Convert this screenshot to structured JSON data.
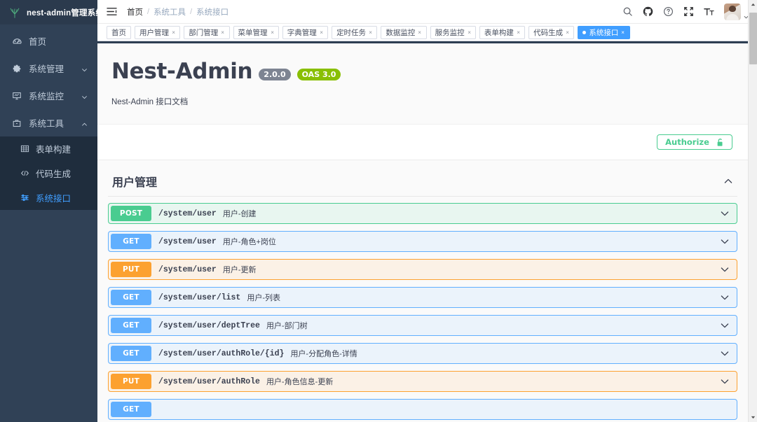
{
  "sidebar": {
    "logo_text": "nest-admin管理系统",
    "logo_icon": "plant-leaf-icon",
    "items": [
      {
        "label": "首页",
        "icon": "dashboard-icon",
        "has_caret": false
      },
      {
        "label": "系统管理",
        "icon": "gear-icon",
        "has_caret": true
      },
      {
        "label": "系统监控",
        "icon": "monitor-icon",
        "has_caret": true
      },
      {
        "label": "系统工具",
        "icon": "toolbox-icon",
        "has_caret": true,
        "expanded": true
      }
    ],
    "submenu": [
      {
        "label": "表单构建",
        "icon": "table-icon",
        "active": false
      },
      {
        "label": "代码生成",
        "icon": "code-icon",
        "active": false
      },
      {
        "label": "系统接口",
        "icon": "sliders-icon",
        "active": true
      }
    ]
  },
  "navbar": {
    "hamburger_icon": "hamburger-icon",
    "breadcrumb": [
      {
        "label": "首页",
        "link": false
      },
      {
        "label": "系统工具",
        "link": true
      },
      {
        "label": "系统接口",
        "link": true
      }
    ],
    "separator": "/",
    "icons": [
      {
        "name": "search-icon"
      },
      {
        "name": "github-icon"
      },
      {
        "name": "help-icon"
      },
      {
        "name": "fullscreen-icon"
      },
      {
        "name": "font-size-icon"
      }
    ],
    "avatar_name": "avatar"
  },
  "tabs": [
    {
      "label": "首页",
      "closable": false,
      "active": false
    },
    {
      "label": "用户管理",
      "closable": true,
      "active": false
    },
    {
      "label": "部门管理",
      "closable": true,
      "active": false
    },
    {
      "label": "菜单管理",
      "closable": true,
      "active": false
    },
    {
      "label": "字典管理",
      "closable": true,
      "active": false
    },
    {
      "label": "定时任务",
      "closable": true,
      "active": false
    },
    {
      "label": "数据监控",
      "closable": true,
      "active": false
    },
    {
      "label": "服务监控",
      "closable": true,
      "active": false
    },
    {
      "label": "表单构建",
      "closable": true,
      "active": false
    },
    {
      "label": "代码生成",
      "closable": true,
      "active": false
    },
    {
      "label": "系统接口",
      "closable": true,
      "active": true
    }
  ],
  "tab_close_glyph": "×",
  "swagger": {
    "title": "Nest-Admin",
    "version_badge": "2.0.0",
    "oas_badge": "OAS 3.0",
    "description": "Nest-Admin 接口文档",
    "authorize_label": "Authorize",
    "authorize_icon": "unlock-icon",
    "section_title": "用户管理",
    "section_collapse_icon": "chevron-up-icon",
    "operations": [
      {
        "verb": "POST",
        "method": "post",
        "path": "/system/user",
        "summary": "用户-创建"
      },
      {
        "verb": "GET",
        "method": "get",
        "path": "/system/user",
        "summary": "用户-角色+岗位"
      },
      {
        "verb": "PUT",
        "method": "put",
        "path": "/system/user",
        "summary": "用户-更新"
      },
      {
        "verb": "GET",
        "method": "get",
        "path": "/system/user/list",
        "summary": "用户-列表"
      },
      {
        "verb": "GET",
        "method": "get",
        "path": "/system/user/deptTree",
        "summary": "用户-部门树"
      },
      {
        "verb": "GET",
        "method": "get",
        "path": "/system/user/authRole/{id}",
        "summary": "用户-分配角色-详情"
      },
      {
        "verb": "PUT",
        "method": "put",
        "path": "/system/user/authRole",
        "summary": "用户-角色信息-更新"
      },
      {
        "verb": "GET",
        "method": "get",
        "path": "",
        "summary": ""
      }
    ]
  },
  "colors": {
    "sidebar_bg": "#304156",
    "submenu_bg": "#1f2d3d",
    "accent": "#409EFF",
    "get": "#61affe",
    "post": "#49cc90",
    "put": "#fca130",
    "oas_green": "#89bf04",
    "version_gray": "#7d8492"
  },
  "scrollbar": {
    "up_icon": "scroll-up-arrow",
    "down_icon": "scroll-down-arrow",
    "thumb": "scroll-thumb"
  }
}
